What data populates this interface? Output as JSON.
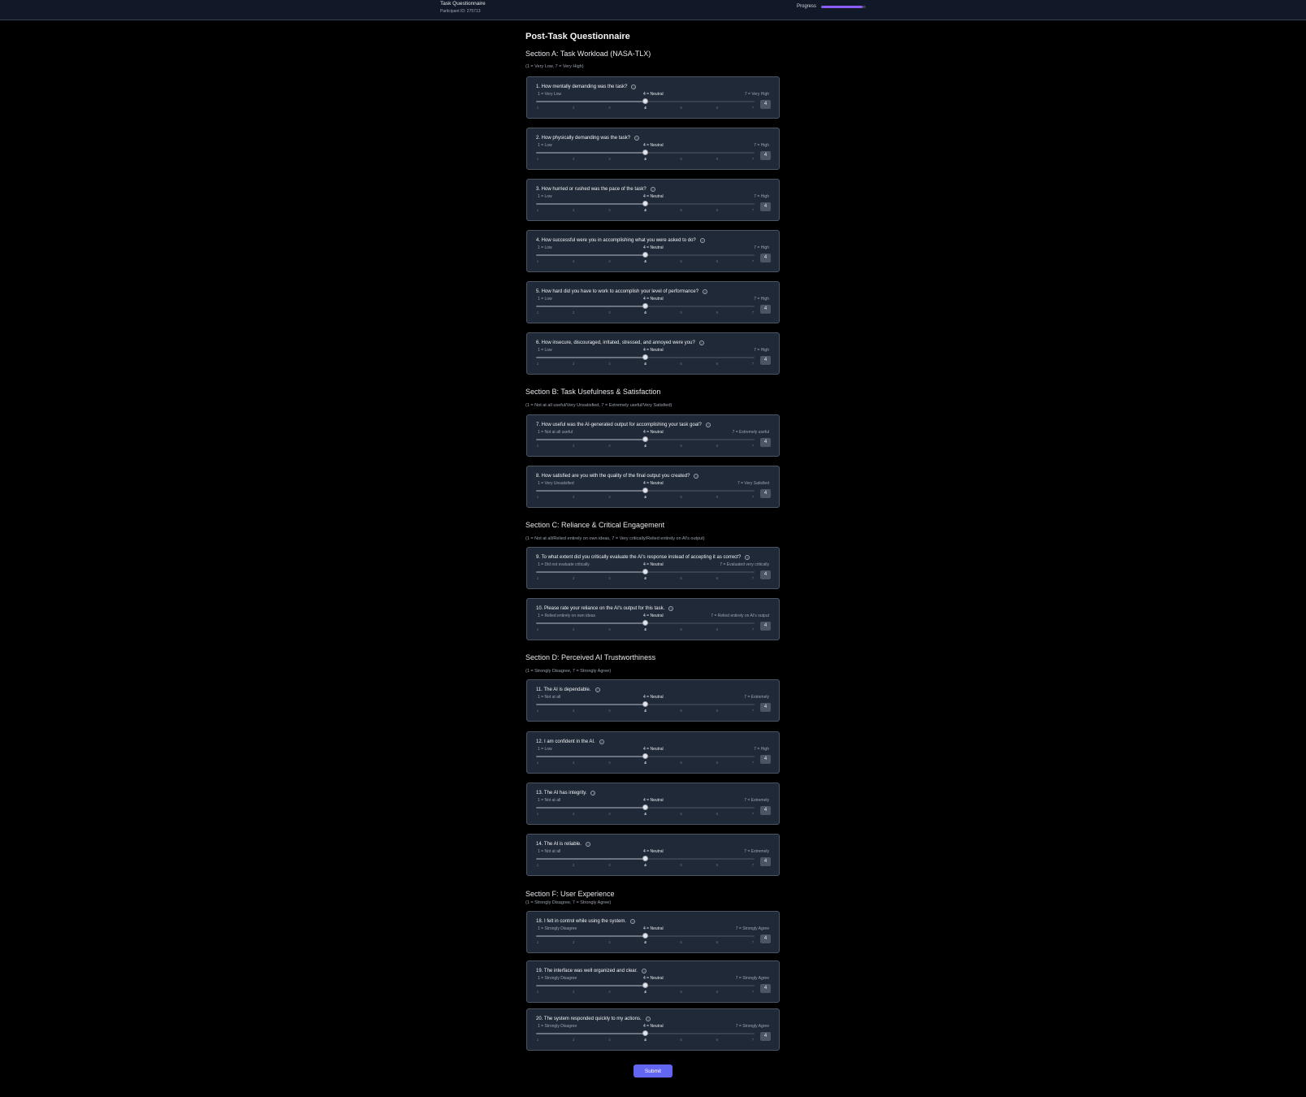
{
  "header": {
    "title": "Task Questionnaire",
    "participant": "Participant ID: 275713",
    "progress_label": "Progress",
    "progress_fraction": 0.92
  },
  "page_title": "Post-Task Questionnaire",
  "scale": {
    "ticks": [
      "1",
      "2",
      "3",
      "4",
      "5",
      "6",
      "7"
    ],
    "neutral_label": "4 = Neutral"
  },
  "sections": [
    {
      "title": "Section A: Task Workload (NASA-TLX)",
      "note": "(1 = Very Low, 7 = Very High)",
      "questions": [
        {
          "text": "1. How mentally demanding was the task?",
          "min": "1 = Very Low",
          "max": "7 = Very High",
          "value": "4"
        },
        {
          "text": "2. How physically demanding was the task?",
          "min": "1 = Low",
          "max": "7 = High",
          "value": "4"
        },
        {
          "text": "3. How hurried or rushed was the pace of the task?",
          "min": "1 = Low",
          "max": "7 = High",
          "value": "4"
        },
        {
          "text": "4. How successful were you in accomplishing what you were asked to do?",
          "min": "1 = Low",
          "max": "7 = High",
          "value": "4"
        },
        {
          "text": "5. How hard did you have to work to accomplish your level of performance?",
          "min": "1 = Low",
          "max": "7 = High",
          "value": "4"
        },
        {
          "text": "6. How insecure, discouraged, irritated, stressed, and annoyed were you?",
          "min": "1 = Low",
          "max": "7 = High",
          "value": "4"
        }
      ]
    },
    {
      "title": "Section B: Task Usefulness & Satisfaction",
      "note": "(1 = Not at all useful/Very Unsatisfied, 7 = Extremely useful/Very Satisfied)",
      "questions": [
        {
          "text": "7. How useful was the AI-generated output for accomplishing your task goal?",
          "min": "1 = Not at all useful",
          "max": "7 = Extremely useful",
          "value": "4"
        },
        {
          "text": "8. How satisfied are you with the quality of the final output you created?",
          "min": "1 = Very Unsatisfied",
          "max": "7 = Very Satisfied",
          "value": "4"
        }
      ]
    },
    {
      "title": "Section C: Reliance & Critical Engagement",
      "note": "(1 = Not at all/Relied entirely on own ideas, 7 = Very critically/Relied entirely on AI's output)",
      "questions": [
        {
          "text": "9. To what extent did you critically evaluate the AI's response instead of accepting it as correct?",
          "min": "1 = Did not evaluate critically",
          "max": "7 = Evaluated very critically",
          "value": "4"
        },
        {
          "text": "10. Please rate your reliance on the AI's output for this task.",
          "min": "1 = Relied entirely on own ideas",
          "max": "7 = Relied entirely on AI's output",
          "value": "4"
        }
      ]
    },
    {
      "title": "Section D: Perceived AI Trustworthiness",
      "note": "(1 = Strongly Disagree, 7 = Strongly Agree)",
      "questions": [
        {
          "text": "11. The AI is dependable.",
          "min": "1 = Not at all",
          "max": "7 = Extremely",
          "value": "4"
        },
        {
          "text": "12. I am confident in the AI.",
          "min": "1 = Low",
          "max": "7 = High",
          "value": "4"
        },
        {
          "text": "13. The AI has integrity.",
          "min": "1 = Not at all",
          "max": "7 = Extremely",
          "value": "4"
        },
        {
          "text": "14. The AI is reliable.",
          "min": "1 = Not at all",
          "max": "7 = Extremely",
          "value": "4"
        }
      ]
    },
    {
      "title": "Section F: User Experience",
      "note": "(1 = Strongly Disagree, 7 = Strongly Agree)",
      "questions": [
        {
          "text": "18. I felt in control while using the system.",
          "min": "1 = Strongly Disagree",
          "max": "7 = Strongly Agree",
          "value": "4"
        },
        {
          "text": "19. The interface was well organized and clear.",
          "min": "1 = Strongly Disagree",
          "max": "7 = Strongly Agree",
          "value": "4"
        },
        {
          "text": "20. The system responded quickly to my actions.",
          "min": "1 = Strongly Disagree",
          "max": "7 = Strongly Agree",
          "value": "4"
        }
      ]
    }
  ],
  "submit_label": "Submit"
}
